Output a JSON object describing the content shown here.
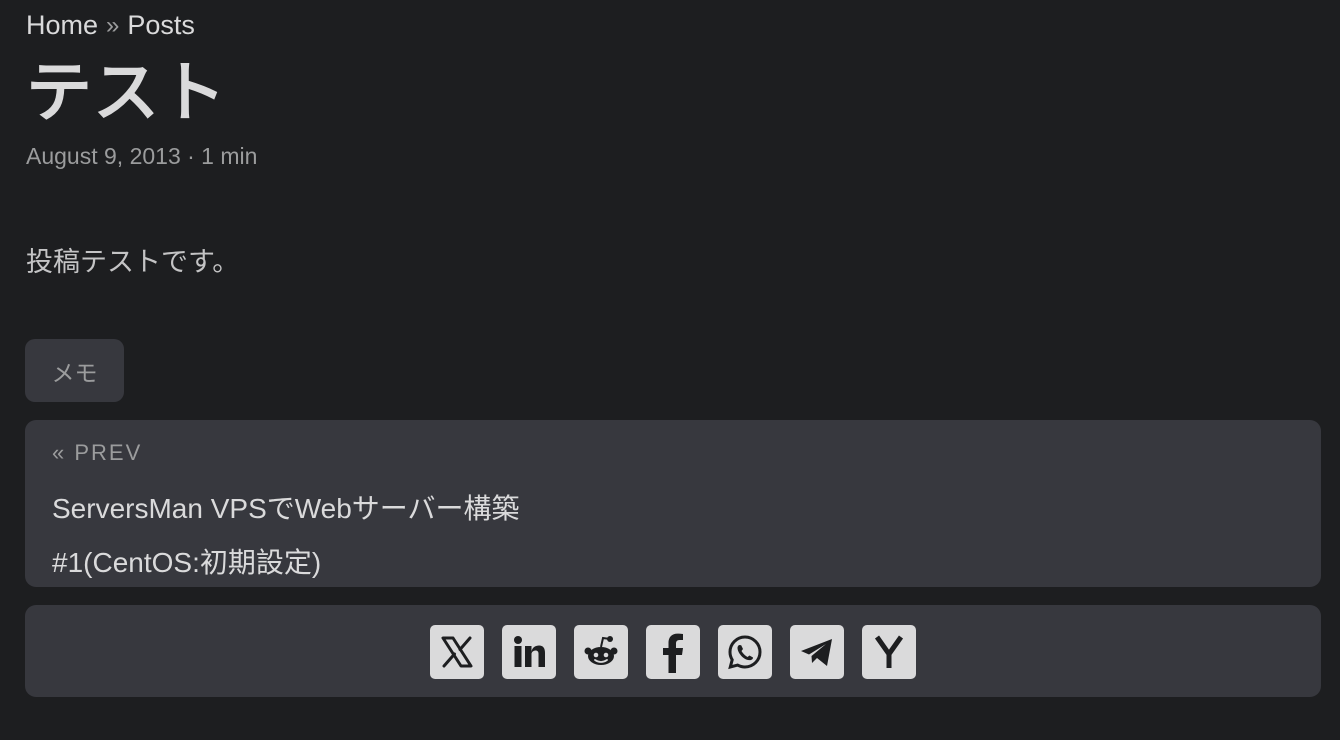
{
  "breadcrumbs": {
    "home": "Home",
    "separator": "»",
    "posts": "Posts"
  },
  "post": {
    "title": "テスト",
    "meta": "August 9, 2013 · 1 min",
    "content": "投稿テストです。"
  },
  "tags": [
    {
      "label": "メモ"
    }
  ],
  "pagination": {
    "prev_label": "« PREV",
    "prev_title_line1": "ServersMan VPSでWebサーバー構築",
    "prev_title_line2": "#1(CentOS:初期設定)"
  },
  "share": {
    "buttons": [
      {
        "icon": "x-twitter-icon"
      },
      {
        "icon": "linkedin-icon"
      },
      {
        "icon": "reddit-icon"
      },
      {
        "icon": "facebook-icon"
      },
      {
        "icon": "whatsapp-icon"
      },
      {
        "icon": "telegram-icon"
      },
      {
        "icon": "ycombinator-icon"
      }
    ]
  },
  "colors": {
    "background": "#1d1e20",
    "card": "#37383e",
    "primary_text": "#dadadb",
    "secondary_text": "#9b9c9d",
    "icon_fill": "#1d1e20"
  }
}
